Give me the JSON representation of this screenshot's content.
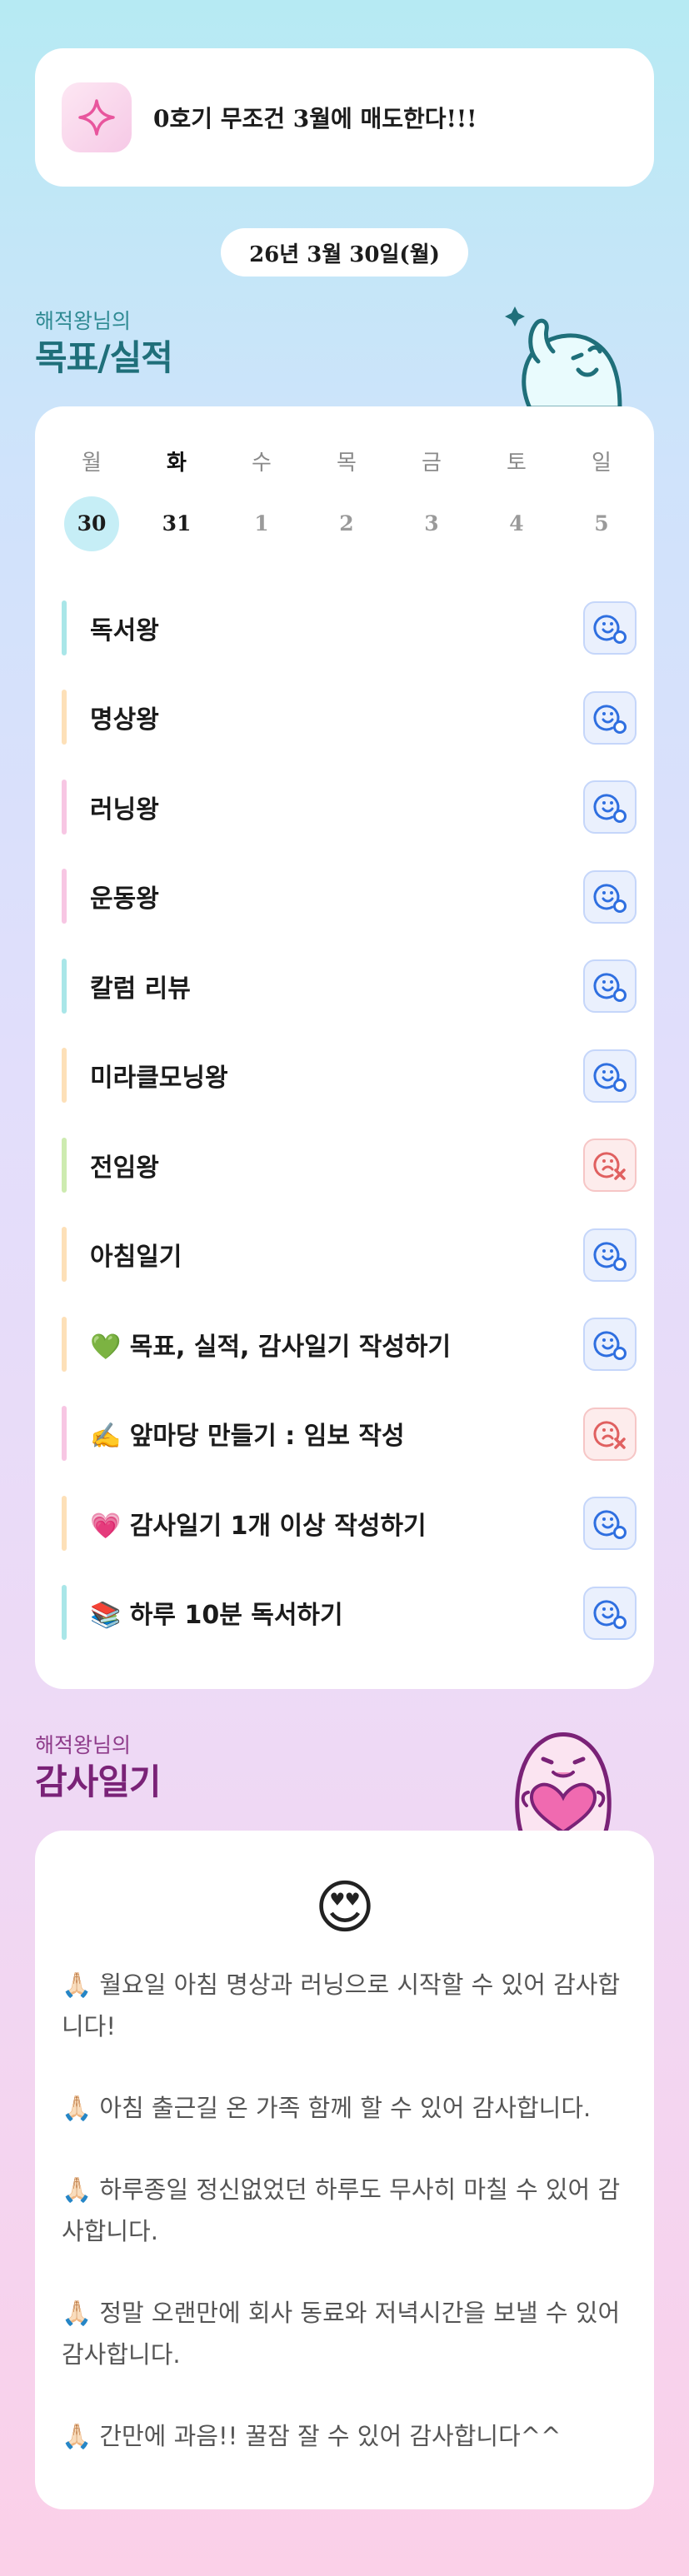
{
  "goal_banner": {
    "icon": "sparkle-icon",
    "text": "0호기 무조건 3월에 매도한다!!!"
  },
  "date_label": "26년 3월 30일(월)",
  "goals_section": {
    "subtitle": "해적왕님의",
    "title": "목표/실적"
  },
  "calendar": {
    "weekdays": [
      "월",
      "화",
      "수",
      "목",
      "금",
      "토",
      "일"
    ],
    "dates": [
      "30",
      "31",
      "1",
      "2",
      "3",
      "4",
      "5"
    ]
  },
  "goals": [
    {
      "label": "독서왕",
      "bar_color": "#a9e6e8",
      "status": "done"
    },
    {
      "label": "명상왕",
      "bar_color": "#fde0b8",
      "status": "done"
    },
    {
      "label": "러닝왕",
      "bar_color": "#f7c6e3",
      "status": "done"
    },
    {
      "label": "운동왕",
      "bar_color": "#f7c6e3",
      "status": "done"
    },
    {
      "label": "칼럼 리뷰",
      "bar_color": "#a9e6e8",
      "status": "done"
    },
    {
      "label": "미라클모닝왕",
      "bar_color": "#fde0b8",
      "status": "done"
    },
    {
      "label": "전임왕",
      "bar_color": "#cdebb0",
      "status": "fail"
    },
    {
      "label": "아침일기",
      "bar_color": "#fde0b8",
      "status": "done"
    },
    {
      "label": "💚 목표, 실적, 감사일기 작성하기",
      "bar_color": "#fde0b8",
      "status": "done"
    },
    {
      "label": "✍️ 앞마당 만들기 : 임보 작성",
      "bar_color": "#f7c6e3",
      "status": "fail"
    },
    {
      "label": "💗 감사일기 1개 이상 작성하기",
      "bar_color": "#fde0b8",
      "status": "done"
    },
    {
      "label": "📚 하루 10분 독서하기",
      "bar_color": "#a9e6e8",
      "status": "done"
    }
  ],
  "gratitude_section": {
    "subtitle": "해적왕님의",
    "title": "감사일기"
  },
  "gratitude": {
    "mood_emoji": "😍",
    "entries": [
      "🙏🏻 월요일 아침 명상과 러닝으로 시작할 수 있어 감사합니다!",
      "🙏🏻 아침 출근길 온 가족 함께 할 수 있어 감사합니다.",
      "🙏🏻 하루종일 정신없었던 하루도 무사히 마칠 수 있어 감사합니다.",
      "🙏🏻 정말 오랜만에 회사 동료와 저녁시간을 보낼 수 있어 감사합니다.",
      "🙏🏻 간만에 과음!! 꿀잠 잘 수 있어 감사합니다^^"
    ]
  },
  "colors": {
    "done_icon": "#2f6fe0",
    "fail_icon": "#e06060",
    "selected_date": "#c6eef6"
  }
}
